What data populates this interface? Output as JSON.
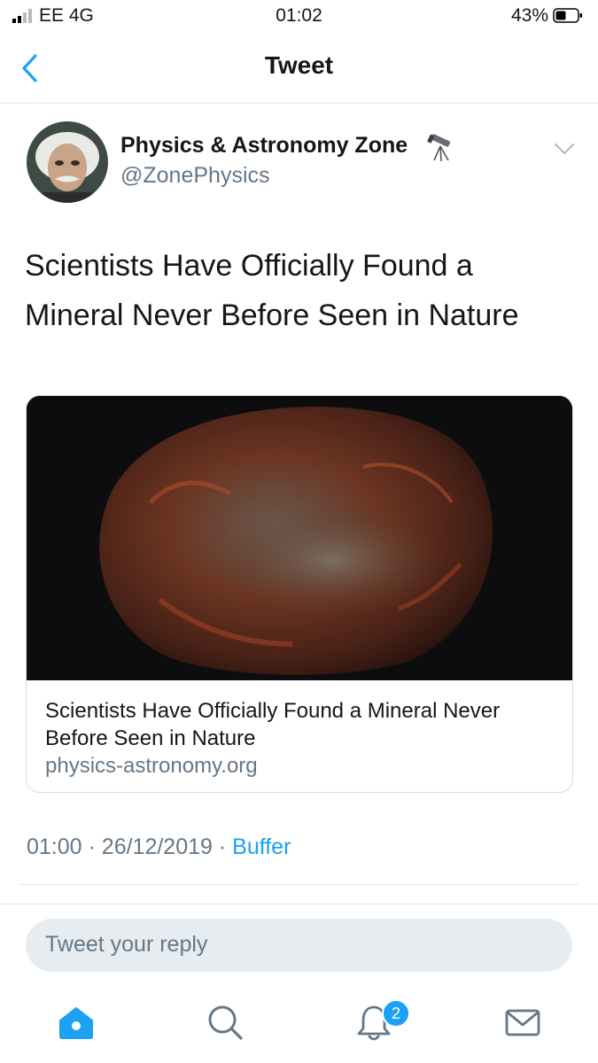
{
  "status_bar": {
    "carrier": "EE 4G",
    "time": "01:02",
    "battery": "43%"
  },
  "nav": {
    "title": "Tweet"
  },
  "tweet": {
    "display_name": "Physics & Astronomy Zone",
    "handle": "@ZonePhysics",
    "text": "Scientists Have Officially Found a Mineral Never Before Seen in Nature",
    "card": {
      "title": "Scientists Have Officially Found a Mineral Never Before Seen in Nature",
      "domain": "physics-astronomy.org"
    },
    "time": "01:00",
    "date": "26/12/2019",
    "separator": "·",
    "source": "Buffer"
  },
  "reply": {
    "placeholder": "Tweet your reply"
  },
  "tabbar": {
    "notifications_count": "2"
  },
  "colors": {
    "accent": "#1da1f2",
    "muted": "#657786",
    "text": "#14171a"
  }
}
